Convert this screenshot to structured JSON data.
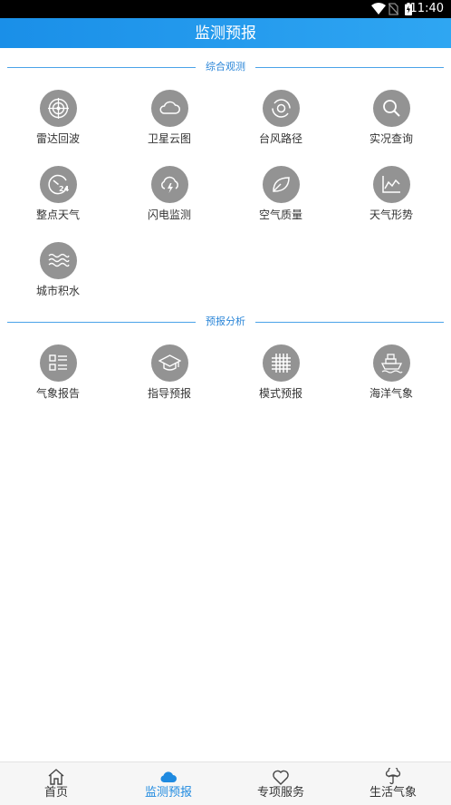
{
  "status_bar": {
    "time": "11:40",
    "icons": [
      "wifi-icon",
      "no-sim-icon",
      "battery-icon"
    ]
  },
  "header": {
    "title": "监测预报"
  },
  "sections": [
    {
      "title": "综合观测",
      "items": [
        {
          "label": "雷达回波",
          "icon": "radar-icon"
        },
        {
          "label": "卫星云图",
          "icon": "cloud-icon"
        },
        {
          "label": "台风路径",
          "icon": "typhoon-icon"
        },
        {
          "label": "实况查询",
          "icon": "search-icon"
        },
        {
          "label": "整点天气",
          "icon": "clock-24-icon"
        },
        {
          "label": "闪电监测",
          "icon": "lightning-cloud-icon"
        },
        {
          "label": "空气质量",
          "icon": "leaf-icon"
        },
        {
          "label": "天气形势",
          "icon": "line-chart-icon"
        },
        {
          "label": "城市积水",
          "icon": "water-waves-icon"
        }
      ]
    },
    {
      "title": "预报分析",
      "items": [
        {
          "label": "气象报告",
          "icon": "report-list-icon"
        },
        {
          "label": "指导预报",
          "icon": "graduation-cap-icon"
        },
        {
          "label": "模式预报",
          "icon": "grid-icon"
        },
        {
          "label": "海洋气象",
          "icon": "ship-icon"
        }
      ]
    }
  ],
  "tab_bar": {
    "active_index": 1,
    "active_color": "#1f8ae0",
    "tabs": [
      {
        "label": "首页",
        "icon": "home-icon"
      },
      {
        "label": "监测预报",
        "icon": "cloud-filled-icon"
      },
      {
        "label": "专项服务",
        "icon": "heart-icon"
      },
      {
        "label": "生活气象",
        "icon": "umbrella-cloud-icon"
      }
    ]
  }
}
